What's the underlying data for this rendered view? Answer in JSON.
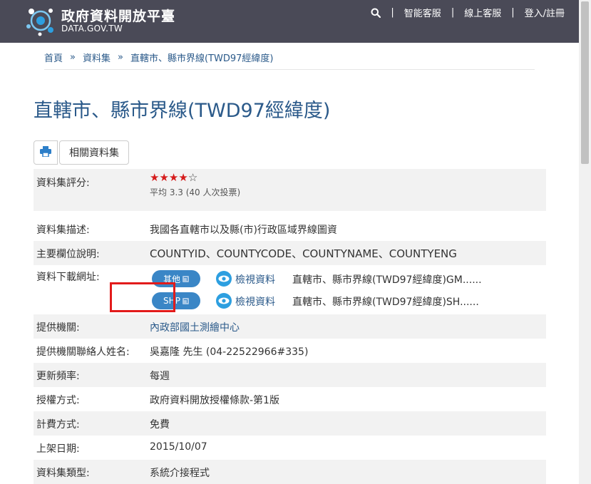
{
  "header": {
    "logo_title": "政府資料開放平臺",
    "logo_subtitle": "DATA.GOV.TW",
    "nav": [
      "智能客服",
      "線上客服",
      "登入/註冊"
    ],
    "separator": "|",
    "bg_color": "#4a4a57"
  },
  "breadcrumb": {
    "items": [
      "首頁",
      "資料集",
      "直轄市、縣市界線(TWD97經緯度)"
    ],
    "arrow": "»"
  },
  "page_title": "直轄市、縣市界線(TWD97經緯度)",
  "toolbar": {
    "print_icon": "printer-icon",
    "related_label": "相關資料集"
  },
  "details": {
    "rating": {
      "label": "資料集評分:",
      "stars_filled": 4,
      "stars_total": 5,
      "summary": "平均 3.3 (40 人次投票)"
    },
    "description": {
      "label": "資料集描述:",
      "value": "我國各直轄市以及縣(市)行政區域界線圖資"
    },
    "fields": {
      "label": "主要欄位說明:",
      "value": "COUNTYID、COUNTYCODE、COUNTYNAME、COUNTYENG"
    },
    "downloads": {
      "label": "資料下載網址:",
      "items": [
        {
          "format": "其他",
          "view_label": "檢視資料",
          "file": "直轄市、縣市界線(TWD97經緯度)GM......"
        },
        {
          "format": "SHP",
          "view_label": "檢視資料",
          "file": "直轄市、縣市界線(TWD97經緯度)SH......"
        }
      ]
    },
    "provider": {
      "label": "提供機關:",
      "value": "內政部國土測繪中心"
    },
    "contact": {
      "label": "提供機關聯絡人姓名:",
      "value": "吳嘉隆 先生 (04-22522966#335)"
    },
    "frequency": {
      "label": "更新頻率:",
      "value": "每週"
    },
    "license": {
      "label": "授權方式:",
      "value": "政府資料開放授權條款-第1版"
    },
    "fee": {
      "label": "計費方式:",
      "value": "免費"
    },
    "published": {
      "label": "上架日期:",
      "value": "2015/10/07"
    },
    "dataset_type": {
      "label": "資料集類型:",
      "value": "系統介接程式"
    }
  },
  "colors": {
    "accent_link": "#2b5a8a",
    "format_button": "#3a86c6",
    "star": "#d51b1b",
    "highlight": "#e21b1b"
  }
}
